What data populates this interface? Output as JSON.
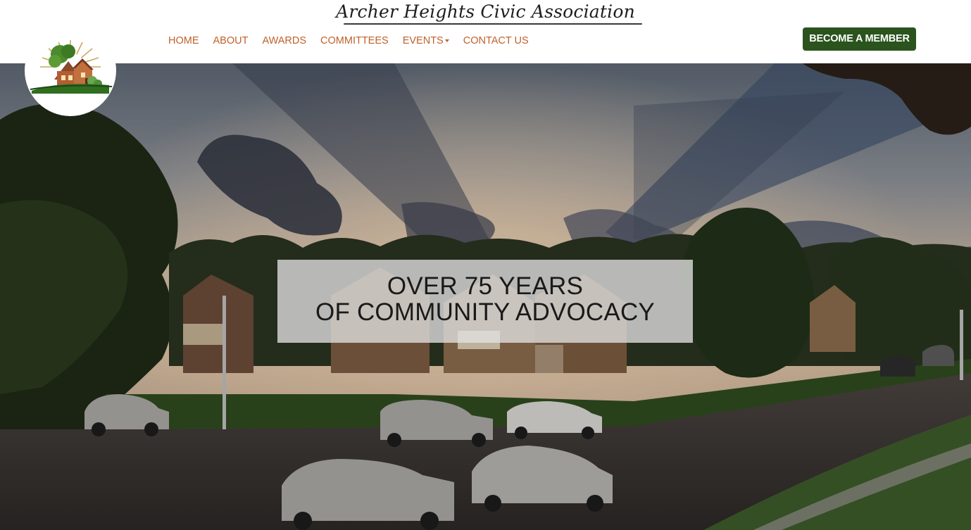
{
  "header": {
    "brand_name": "Archer Heights Civic Association",
    "cta_label": "BECOME A MEMBER"
  },
  "nav": {
    "items": [
      {
        "label": "HOME"
      },
      {
        "label": "ABOUT"
      },
      {
        "label": "AWARDS"
      },
      {
        "label": "COMMITTEES"
      },
      {
        "label": "EVENTS",
        "has_dropdown": true
      },
      {
        "label": "CONTACT US"
      }
    ]
  },
  "hero": {
    "tagline_line1": "OVER 75 YEARS",
    "tagline_line2": "OF COMMUNITY ADVOCACY"
  },
  "colors": {
    "nav_text": "#c0612a",
    "cta_background": "#2a531d",
    "tagline_box": "rgba(225,225,225,0.78)"
  }
}
